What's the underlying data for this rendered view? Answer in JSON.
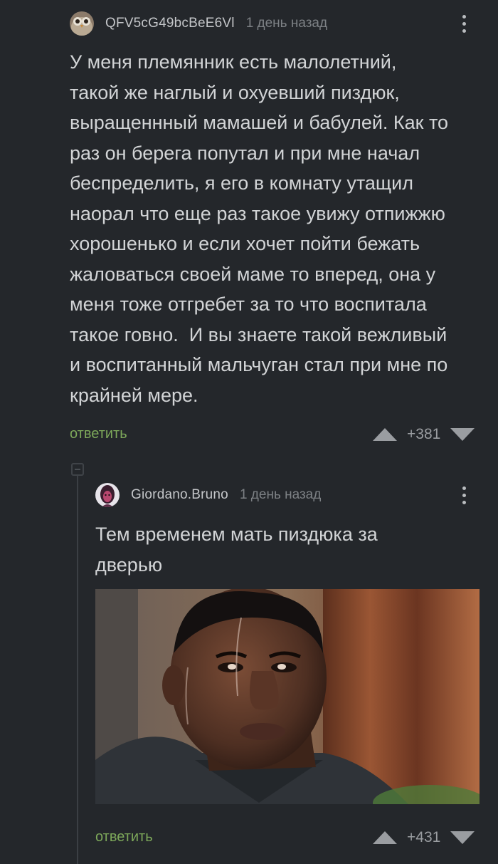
{
  "comment": {
    "username": "QFV5cG49bcBeE6Vl",
    "time": "1 день назад",
    "text": "У меня племянник есть малолетний,\nтакой же наглый и охуевший пиздюк,\nвыращеннный мамашей и бабулей. Как то\nраз он берега попутал и при мне начал\nбеспределить, я его в комнату утащил\nнаорал что еще раз такое увижу отпижжю\nхорошенько и если хочет пойти бежать\nжаловаться своей маме то вперед, она у\nменя тоже отгребет за то что воспитала\nтакое говно.  И вы знаете такой вежливый\nи воспитанный мальчуган стал при мне по\nкрайней мере.",
    "reply_label": "ответить",
    "score": "+381",
    "avatar_icon": "owl-avatar-icon"
  },
  "reply": {
    "username": "Giordano.Bruno",
    "time": "1 день назад",
    "text": "Тем временем мать пиздюка за\nдверью",
    "reply_label": "ответить",
    "score": "+431",
    "avatar_icon": "portrait-avatar-icon",
    "image_description_icon": "sweating-man-photo"
  },
  "colors": {
    "background": "#24272b",
    "accent": "#7da85a",
    "text": "#d2d4d6",
    "muted": "#7d8185"
  }
}
